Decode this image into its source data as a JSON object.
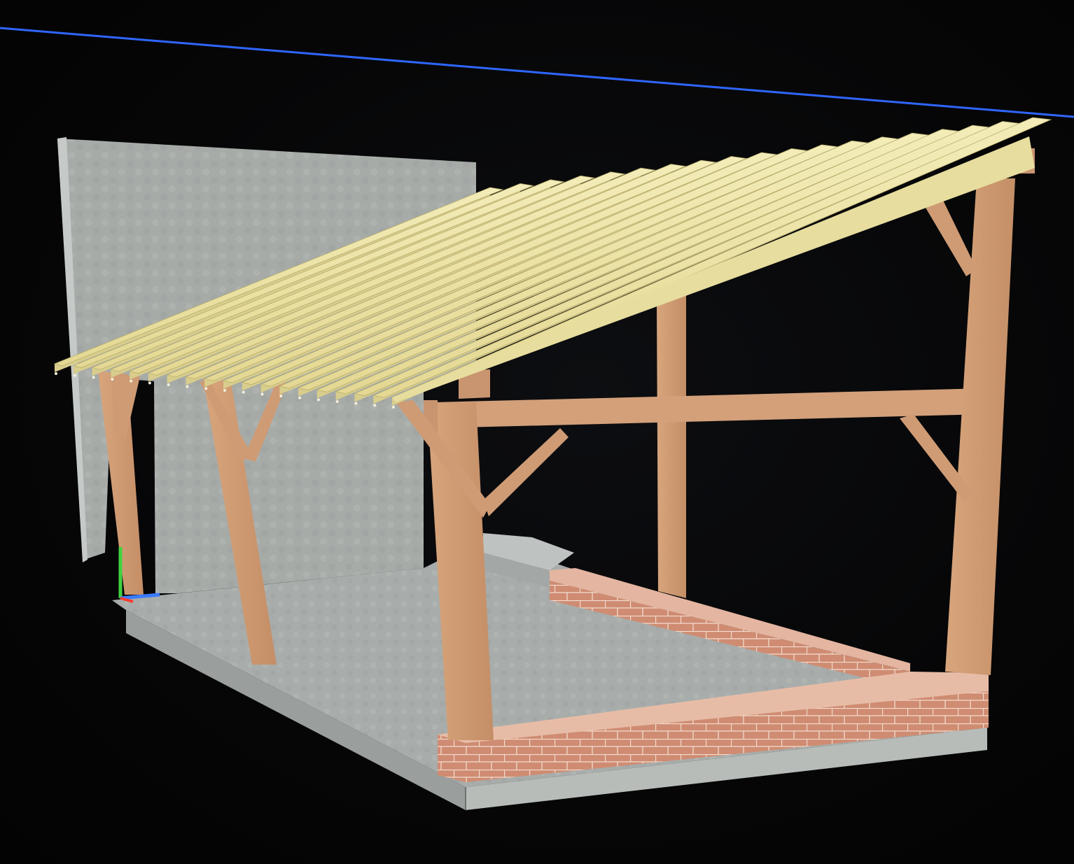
{
  "viewport": {
    "background_color": "#060607",
    "guide_line_color": "#2f66ff"
  },
  "model": {
    "elements": [
      {
        "name": "back-wall",
        "material": "concrete",
        "color": "#a7aca9"
      },
      {
        "name": "floor-slab",
        "material": "concrete",
        "color": "#a9aeac"
      },
      {
        "name": "brick-plinth",
        "material": "brick",
        "color": "#d08e75"
      },
      {
        "name": "timber-posts",
        "material": "oak",
        "color": "#cf9b74"
      },
      {
        "name": "roof-rafters",
        "material": "pine",
        "color": "#ece2a2"
      }
    ]
  },
  "axis_gizmo": {
    "icon": "xyz-axis-icon",
    "colors": {
      "x": "#ff3b30",
      "y": "#3fd23f",
      "z": "#3b7bff"
    }
  }
}
